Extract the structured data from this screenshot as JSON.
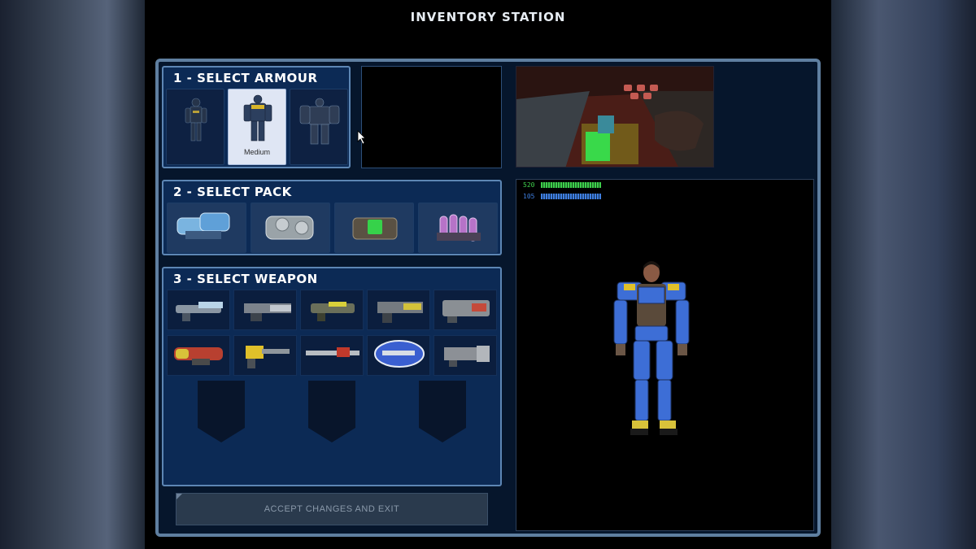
{
  "screen_title": "INVENTORY STATION",
  "armour": {
    "title": "1 - SELECT ARMOUR",
    "options": [
      {
        "name": "light-armour",
        "caption": ""
      },
      {
        "name": "medium-armour",
        "caption": "Medium",
        "selected": true
      },
      {
        "name": "heavy-armour",
        "caption": ""
      }
    ]
  },
  "pack": {
    "title": "2 - SELECT PACK",
    "options": [
      "energy-pack",
      "shield-pack",
      "repair-pack",
      "ammo-pack"
    ]
  },
  "weapon": {
    "title": "3 - SELECT WEAPON",
    "rows": [
      [
        "blaster",
        "chaingun",
        "disc-launcher",
        "grenade-launcher",
        "mortar"
      ],
      [
        "fusion-mortar",
        "plasma-rifle",
        "laser-rifle",
        "shocklance",
        "missile-launcher"
      ]
    ],
    "empty_slots": 3
  },
  "stats": {
    "health": "520",
    "energy": "105",
    "health_fraction": 0.9,
    "energy_fraction": 0.9
  },
  "colors": {
    "panel_bg": "#0c2a55",
    "panel_border": "#5d86b4",
    "frame_border": "#5f7fa0",
    "health_green": "#3fcf4c",
    "energy_blue": "#3f7fe0"
  },
  "buttons": {
    "accept_label": "ACCEPT CHANGES AND EXIT"
  }
}
